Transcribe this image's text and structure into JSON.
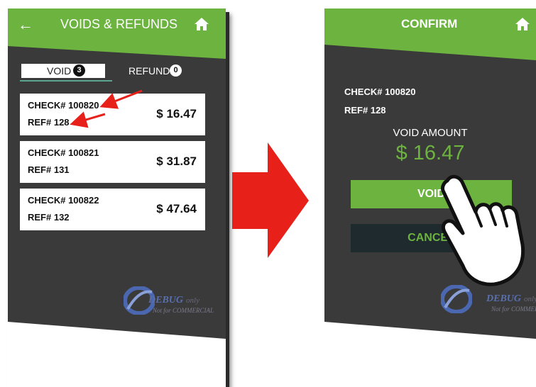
{
  "left_screen": {
    "header": {
      "title": "VOIDS & REFUNDS",
      "back_icon": "back-arrow-icon",
      "home_icon": "home-icon"
    },
    "tabs": [
      {
        "label": "VOID",
        "count": "3",
        "active": true
      },
      {
        "label": "REFUND",
        "count": "0",
        "active": false
      }
    ],
    "checks": [
      {
        "check": "CHECK# 100820",
        "ref": "REF# 128",
        "amount": "$ 16.47"
      },
      {
        "check": "CHECK# 100821",
        "ref": "REF# 131",
        "amount": "$ 31.87"
      },
      {
        "check": "CHECK# 100822",
        "ref": "REF# 132",
        "amount": "$ 47.64"
      }
    ],
    "watermark": {
      "debug": "DEBUG",
      "only": "only",
      "sub": "Not for COMMERCIAL"
    }
  },
  "right_screen": {
    "header": {
      "title": "CONFIRM",
      "home_icon": "home-icon"
    },
    "check": "CHECK# 100820",
    "ref": "REF# 128",
    "void_amount_label": "VOID AMOUNT",
    "void_amount": "$ 16.47",
    "void_button": "VOID",
    "cancel_button": "CANCEL",
    "watermark": {
      "debug": "DEBUG",
      "only": "only",
      "sub": "Not for COMMERCIAL"
    }
  },
  "colors": {
    "brand_green": "#6db33f",
    "dark_background": "#3a3a3a",
    "cancel_button": "#1e2a2e",
    "annotation_red": "#e8201a"
  },
  "annotations": {
    "transition_arrow": "red-right-arrow-icon",
    "pointer": "pointing-hand-icon"
  }
}
